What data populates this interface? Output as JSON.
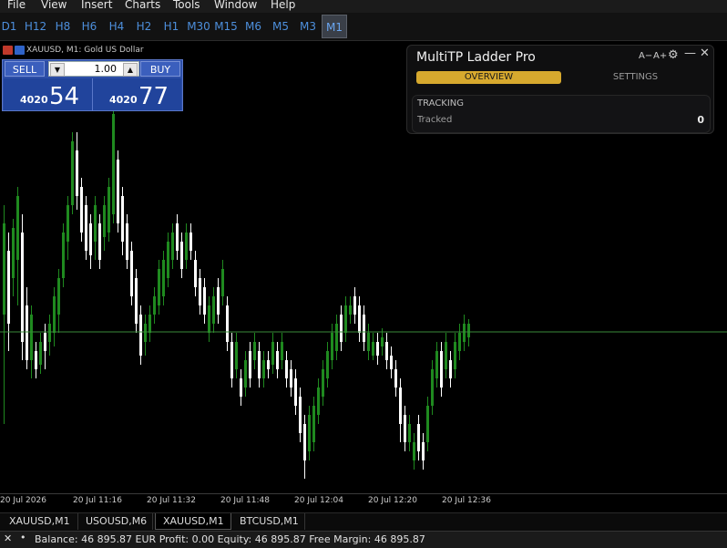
{
  "menu": [
    "File",
    "View",
    "Insert",
    "Charts",
    "Tools",
    "Window",
    "Help"
  ],
  "timeframes": [
    "D1",
    "H12",
    "H8",
    "H6",
    "H4",
    "H2",
    "H1",
    "M30",
    "M15",
    "M6",
    "M5",
    "M3",
    "M1"
  ],
  "active_timeframe": "M1",
  "chart_header": {
    "symbol_text": "XAUUSD, M1:  Gold US Dollar"
  },
  "trade_panel": {
    "sell_label": "SELL",
    "buy_label": "BUY",
    "lot": "1.00",
    "sell_price_prefix": "4020",
    "sell_price_big": "54",
    "buy_price_prefix": "4020",
    "buy_price_big": "77"
  },
  "multitp": {
    "title": "MultiTP Ladder Pro",
    "font_minus": "A−",
    "font_plus": "A+",
    "tab_overview": "OVERVIEW",
    "tab_settings": "SETTINGS",
    "section_title": "TRACKING",
    "tracked_label": "Tracked",
    "tracked_value": "0"
  },
  "time_axis": [
    "20 Jul 2026",
    "20 Jul 11:16",
    "20 Jul 11:32",
    "20 Jul 11:48",
    "20 Jul 12:04",
    "20 Jul 12:20",
    "20 Jul 12:36"
  ],
  "symbol_tabs": [
    "XAUUSD,M1",
    "USOUSD,M6",
    "XAUUSD,M1",
    "BTCUSD,M1"
  ],
  "active_symbol_tab": 2,
  "status": {
    "close": "✕",
    "bullet": "•",
    "text": "Balance: 46 895.87 EUR  Profit: 0.00  Equity: 46 895.87  Free Margin: 46 895.87"
  },
  "colors": {
    "bull": "#1f8a1f",
    "bear": "#ffffff",
    "bid_line": "#3a8a3a",
    "accent_gold": "#d7a92e",
    "trade_blue": "#2c4ea7"
  }
}
